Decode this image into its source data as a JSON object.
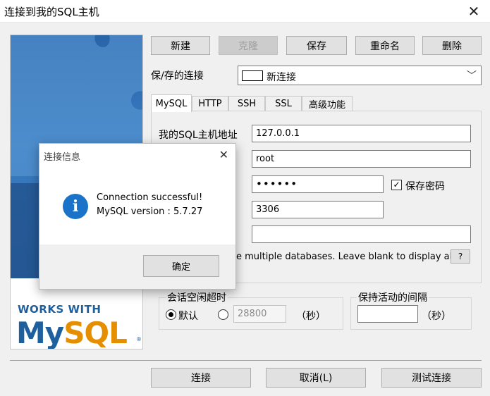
{
  "window": {
    "title": "连接到我的SQL主机"
  },
  "toolbar": {
    "new": "新建",
    "clone": "克隆",
    "save": "保存",
    "rename": "重命名",
    "delete": "删除"
  },
  "saved_connection": {
    "label": "保/存的连接",
    "value": "新连接"
  },
  "tabs": [
    {
      "label": "MySQL",
      "active": true
    },
    {
      "label": "HTTP"
    },
    {
      "label": "SSH"
    },
    {
      "label": "SSL"
    },
    {
      "label": "高级功能"
    }
  ],
  "form": {
    "host_label": "我的SQL主机地址",
    "host": "127.0.0.1",
    "user": "root",
    "password": "••••••",
    "save_password": "保存密码",
    "save_password_checked": true,
    "port": "3306",
    "database": "",
    "databases_hint": "e multiple databases. Leave blank to display all)",
    "help": "?"
  },
  "session_timeout": {
    "label": "会话空闲超时",
    "default": "默认",
    "value": "28800",
    "unit": "（秒）"
  },
  "keepalive": {
    "label": "保持活动的间隔",
    "value": "",
    "unit": "（秒）"
  },
  "banner": {
    "works_with": "WORKS WITH",
    "logo_my": "My",
    "logo_sql": "SQL",
    "trademark": "®"
  },
  "footer": {
    "connect": "连接",
    "cancel": "取消(L)",
    "test": "测试连接"
  },
  "dialog": {
    "title": "连接信息",
    "line1": "Connection successful!",
    "line2": "MySQL version : 5.7.27",
    "ok": "确定"
  }
}
